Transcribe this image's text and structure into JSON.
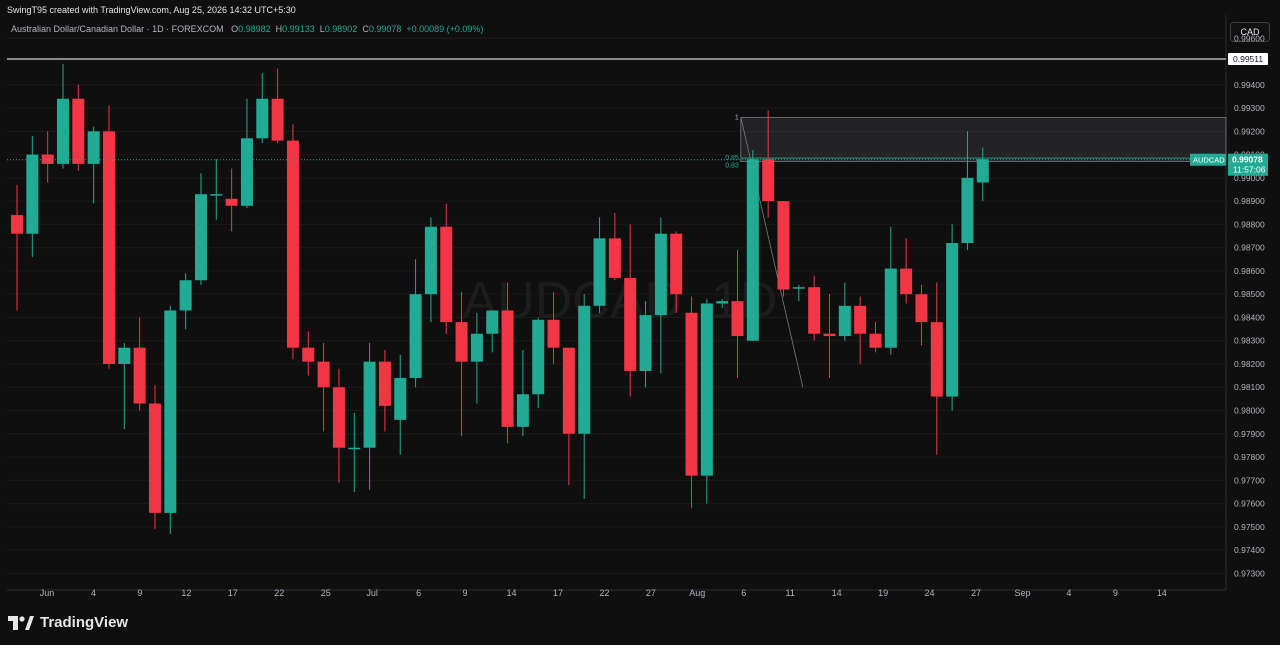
{
  "header": {
    "created_by": "SwingT95 created with TradingView.com, Aug 25, 2026 14:32 UTC+5:30",
    "symbol_title": "Australian Dollar/Canadian Dollar · 1D · FOREXCOM",
    "o_label": "O",
    "o_value": "0.98982",
    "h_label": "H",
    "h_value": "0.99133",
    "l_label": "L",
    "l_value": "0.98902",
    "c_label": "C",
    "c_value": "0.99078",
    "change": "+0.00089 (+0.09%)"
  },
  "currency_button": "CAD",
  "watermark": "AUDCAD, 1D",
  "footer": {
    "brand": "TradingView"
  },
  "colors": {
    "up": "#22ab94",
    "down": "#f23645",
    "background": "#0f0f0f",
    "grid": "#1a1a1a"
  },
  "chart_data": {
    "type": "candlestick",
    "symbol": "AUDCAD",
    "ylim": [
      0.9725,
      0.997
    ],
    "y_ticks": [
      "0.99600",
      "0.99400",
      "0.99300",
      "0.99200",
      "0.99100",
      "0.99000",
      "0.98900",
      "0.98800",
      "0.98700",
      "0.98600",
      "0.98500",
      "0.98400",
      "0.98300",
      "0.98200",
      "0.98100",
      "0.98000",
      "0.97900",
      "0.97800",
      "0.97700",
      "0.97600",
      "0.97500",
      "0.97400",
      "0.97300"
    ],
    "x_ticks": [
      "Jun",
      "4",
      "9",
      "12",
      "17",
      "22",
      "25",
      "Jul",
      "6",
      "9",
      "14",
      "17",
      "22",
      "27",
      "Aug",
      "6",
      "11",
      "14",
      "19",
      "24",
      "27",
      "Sep",
      "4",
      "9",
      "14"
    ],
    "candles": [
      {
        "o": 0.9884,
        "h": 0.9897,
        "l": 0.9843,
        "c": 0.9876
      },
      {
        "o": 0.9876,
        "h": 0.9918,
        "l": 0.9866,
        "c": 0.991
      },
      {
        "o": 0.991,
        "h": 0.992,
        "l": 0.9898,
        "c": 0.9906
      },
      {
        "o": 0.9906,
        "h": 0.9949,
        "l": 0.9904,
        "c": 0.9934
      },
      {
        "o": 0.9934,
        "h": 0.994,
        "l": 0.9903,
        "c": 0.9906
      },
      {
        "o": 0.9906,
        "h": 0.9922,
        "l": 0.9889,
        "c": 0.992
      },
      {
        "o": 0.992,
        "h": 0.9931,
        "l": 0.9818,
        "c": 0.982
      },
      {
        "o": 0.982,
        "h": 0.9829,
        "l": 0.9792,
        "c": 0.9827
      },
      {
        "o": 0.9827,
        "h": 0.984,
        "l": 0.98,
        "c": 0.9803
      },
      {
        "o": 0.9803,
        "h": 0.9811,
        "l": 0.9749,
        "c": 0.9756
      },
      {
        "o": 0.9756,
        "h": 0.9845,
        "l": 0.9747,
        "c": 0.9843
      },
      {
        "o": 0.9843,
        "h": 0.9859,
        "l": 0.9835,
        "c": 0.9856
      },
      {
        "o": 0.9856,
        "h": 0.9902,
        "l": 0.9854,
        "c": 0.9893
      },
      {
        "o": 0.9893,
        "h": 0.9908,
        "l": 0.9882,
        "c": 0.9893
      },
      {
        "o": 0.9891,
        "h": 0.9904,
        "l": 0.9877,
        "c": 0.9888
      },
      {
        "o": 0.9888,
        "h": 0.9934,
        "l": 0.9887,
        "c": 0.9917
      },
      {
        "o": 0.9917,
        "h": 0.9945,
        "l": 0.9915,
        "c": 0.9934
      },
      {
        "o": 0.9934,
        "h": 0.9947,
        "l": 0.9915,
        "c": 0.9916
      },
      {
        "o": 0.9916,
        "h": 0.9923,
        "l": 0.9822,
        "c": 0.9827
      },
      {
        "o": 0.9827,
        "h": 0.9834,
        "l": 0.9815,
        "c": 0.9821
      },
      {
        "o": 0.9821,
        "h": 0.9829,
        "l": 0.9791,
        "c": 0.981
      },
      {
        "o": 0.981,
        "h": 0.9818,
        "l": 0.9769,
        "c": 0.9784
      },
      {
        "o": 0.9784,
        "h": 0.9799,
        "l": 0.9765,
        "c": 0.9784
      },
      {
        "o": 0.9784,
        "h": 0.9829,
        "l": 0.9766,
        "c": 0.9821
      },
      {
        "o": 0.9821,
        "h": 0.9826,
        "l": 0.9791,
        "c": 0.9802
      },
      {
        "o": 0.9796,
        "h": 0.9824,
        "l": 0.9781,
        "c": 0.9814
      },
      {
        "o": 0.9814,
        "h": 0.9865,
        "l": 0.981,
        "c": 0.985
      },
      {
        "o": 0.985,
        "h": 0.9883,
        "l": 0.9838,
        "c": 0.9879
      },
      {
        "o": 0.9879,
        "h": 0.9889,
        "l": 0.9833,
        "c": 0.9838
      },
      {
        "o": 0.9838,
        "h": 0.9851,
        "l": 0.9789,
        "c": 0.9821
      },
      {
        "o": 0.9821,
        "h": 0.9842,
        "l": 0.9803,
        "c": 0.9833
      },
      {
        "o": 0.9833,
        "h": 0.9842,
        "l": 0.9825,
        "c": 0.9843
      },
      {
        "o": 0.9843,
        "h": 0.9855,
        "l": 0.9786,
        "c": 0.9793
      },
      {
        "o": 0.9793,
        "h": 0.9826,
        "l": 0.9789,
        "c": 0.9807
      },
      {
        "o": 0.9807,
        "h": 0.984,
        "l": 0.9801,
        "c": 0.9839
      },
      {
        "o": 0.9839,
        "h": 0.9851,
        "l": 0.982,
        "c": 0.9827
      },
      {
        "o": 0.9827,
        "h": 0.9827,
        "l": 0.9768,
        "c": 0.979
      },
      {
        "o": 0.979,
        "h": 0.985,
        "l": 0.9762,
        "c": 0.9845
      },
      {
        "o": 0.9845,
        "h": 0.9883,
        "l": 0.9842,
        "c": 0.9874
      },
      {
        "o": 0.9874,
        "h": 0.9885,
        "l": 0.9856,
        "c": 0.9857
      },
      {
        "o": 0.9857,
        "h": 0.988,
        "l": 0.9806,
        "c": 0.9817
      },
      {
        "o": 0.9817,
        "h": 0.9847,
        "l": 0.981,
        "c": 0.9841
      },
      {
        "o": 0.9841,
        "h": 0.9883,
        "l": 0.9816,
        "c": 0.9876
      },
      {
        "o": 0.9876,
        "h": 0.9877,
        "l": 0.9842,
        "c": 0.985
      },
      {
        "o": 0.9842,
        "h": 0.9849,
        "l": 0.9758,
        "c": 0.9772
      },
      {
        "o": 0.9772,
        "h": 0.9848,
        "l": 0.976,
        "c": 0.9846
      },
      {
        "o": 0.9846,
        "h": 0.9848,
        "l": 0.9844,
        "c": 0.9847
      },
      {
        "o": 0.9847,
        "h": 0.9869,
        "l": 0.9814,
        "c": 0.9832
      },
      {
        "o": 0.983,
        "h": 0.9912,
        "l": 0.983,
        "c": 0.9908
      },
      {
        "o": 0.9908,
        "h": 0.9929,
        "l": 0.9883,
        "c": 0.989
      },
      {
        "o": 0.989,
        "h": 0.989,
        "l": 0.9849,
        "c": 0.9852
      },
      {
        "o": 0.9853,
        "h": 0.9854,
        "l": 0.9847,
        "c": 0.9853
      },
      {
        "o": 0.9853,
        "h": 0.9858,
        "l": 0.983,
        "c": 0.9833
      },
      {
        "o": 0.9833,
        "h": 0.985,
        "l": 0.9814,
        "c": 0.9832
      },
      {
        "o": 0.9832,
        "h": 0.9855,
        "l": 0.983,
        "c": 0.9845
      },
      {
        "o": 0.9845,
        "h": 0.9849,
        "l": 0.982,
        "c": 0.9833
      },
      {
        "o": 0.9833,
        "h": 0.9838,
        "l": 0.9825,
        "c": 0.9827
      },
      {
        "o": 0.9827,
        "h": 0.9879,
        "l": 0.9824,
        "c": 0.9861
      },
      {
        "o": 0.9861,
        "h": 0.9874,
        "l": 0.9846,
        "c": 0.985
      },
      {
        "o": 0.985,
        "h": 0.9854,
        "l": 0.9828,
        "c": 0.9838
      },
      {
        "o": 0.9838,
        "h": 0.9855,
        "l": 0.9781,
        "c": 0.9806
      },
      {
        "o": 0.9806,
        "h": 0.988,
        "l": 0.98,
        "c": 0.9872
      },
      {
        "o": 0.9872,
        "h": 0.992,
        "l": 0.9869,
        "c": 0.99
      },
      {
        "o": 0.9898,
        "h": 0.9913,
        "l": 0.989,
        "c": 0.9908
      }
    ],
    "horizontal_line": {
      "price": 0.99511,
      "label": "0.99511"
    },
    "last_price": {
      "price": 0.99078,
      "symbol_label": "AUDCAD",
      "price_label": "0.99078",
      "countdown": "11:57:06"
    },
    "zone": {
      "top": 0.9926,
      "bottom": 0.9907
    },
    "fib_labels": [
      "1",
      "0.85",
      "0.83"
    ]
  }
}
